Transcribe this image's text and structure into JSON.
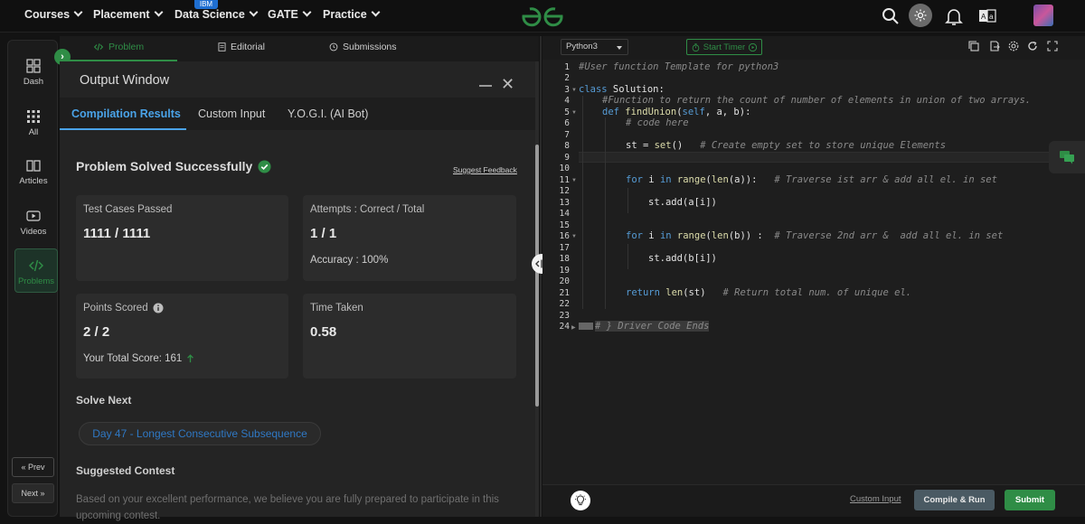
{
  "colors": {
    "accent_green": "#2f8d46",
    "accent_blue": "#4aa3e8",
    "bg": "#131313"
  },
  "nav": {
    "items": [
      {
        "label": "Courses"
      },
      {
        "label": "Placement"
      },
      {
        "label": "Data Science"
      },
      {
        "label": "GATE"
      },
      {
        "label": "Practice"
      }
    ],
    "ibm_badge": "IBM",
    "logo_icon": "gfg-logo",
    "icons": [
      "search-icon",
      "theme-toggle-icon",
      "bell-icon",
      "translate-icon",
      "avatar"
    ]
  },
  "rail": {
    "items": [
      {
        "label": "Dash",
        "icon": "dashboard-icon"
      },
      {
        "label": "All",
        "icon": "grid-icon"
      },
      {
        "label": "Articles",
        "icon": "book-icon"
      },
      {
        "label": "Videos",
        "icon": "video-icon"
      },
      {
        "label": "Problems",
        "icon": "code-icon"
      }
    ],
    "prev": "« Prev",
    "next": "Next »"
  },
  "problem_tabs": [
    {
      "label": "Problem",
      "icon": "code-icon"
    },
    {
      "label": "Editorial",
      "icon": "document-icon"
    },
    {
      "label": "Submissions",
      "icon": "clock-icon"
    }
  ],
  "output": {
    "title": "Output Window",
    "tabs": [
      "Compilation Results",
      "Custom Input",
      "Y.O.G.I. (AI Bot)"
    ],
    "status": "Problem Solved Successfully",
    "feedback": "Suggest Feedback",
    "cards": {
      "tests": {
        "label": "Test Cases Passed",
        "value": "1111 / 1111"
      },
      "attempts": {
        "label": "Attempts : Correct / Total",
        "value": "1 / 1",
        "sub": "Accuracy : 100%"
      },
      "points": {
        "label": "Points Scored",
        "value": "2 / 2",
        "sub": "Your Total Score: 161"
      },
      "time": {
        "label": "Time Taken",
        "value": "0.58"
      }
    },
    "solve_next_heading": "Solve Next",
    "solve_next_chip": "Day 47 - Longest Consecutive Subsequence",
    "contest_heading": "Suggested Contest",
    "contest_desc": "Based on your excellent performance, we believe you are fully prepared to participate in this upcoming contest."
  },
  "editor": {
    "language": "Python3",
    "timer": "Start Timer",
    "line_numbers": [
      "1",
      "2",
      "3",
      "4",
      "5",
      "6",
      "7",
      "8",
      "9",
      "10",
      "11",
      "12",
      "13",
      "14",
      "15",
      "16",
      "17",
      "18",
      "19",
      "20",
      "21",
      "22",
      "23",
      "24"
    ],
    "lines": {
      "l1": "#User function Template for python3",
      "l3a": "class",
      "l3b": " Solution:",
      "l4": "#Function to return the count of number of elements in union of two arrays.",
      "l5a": "def",
      "l5b": " findUnion",
      "l5c": "(",
      "l5d": "self",
      "l5e": ", a, b):",
      "l6": "# code here",
      "l8a": "st = ",
      "l8b": "set",
      "l8c": "()",
      "l8d": "   # Create empty set to store unique Elements",
      "l11a": "for",
      "l11b": " i ",
      "l11c": "in",
      "l11d": " range",
      "l11e": "(",
      "l11f": "len",
      "l11g": "(a)):",
      "l11h": "   # Traverse ist arr & add all el. in set",
      "l13": "st.add(a[i])",
      "l16a": "for",
      "l16b": " i ",
      "l16c": "in",
      "l16d": " range",
      "l16e": "(",
      "l16f": "len",
      "l16g": "(b)) : ",
      "l16h": " # Traverse 2nd arr &  add all el. in set",
      "l18": "st.add(b[i])",
      "l21a": "return",
      "l21b": " len",
      "l21c": "(st)",
      "l21d": "   # Return total num. of unique el.",
      "l24": "# } Driver Code Ends"
    },
    "custom_input": "Custom Input",
    "compile_run": "Compile & Run",
    "submit": "Submit"
  }
}
